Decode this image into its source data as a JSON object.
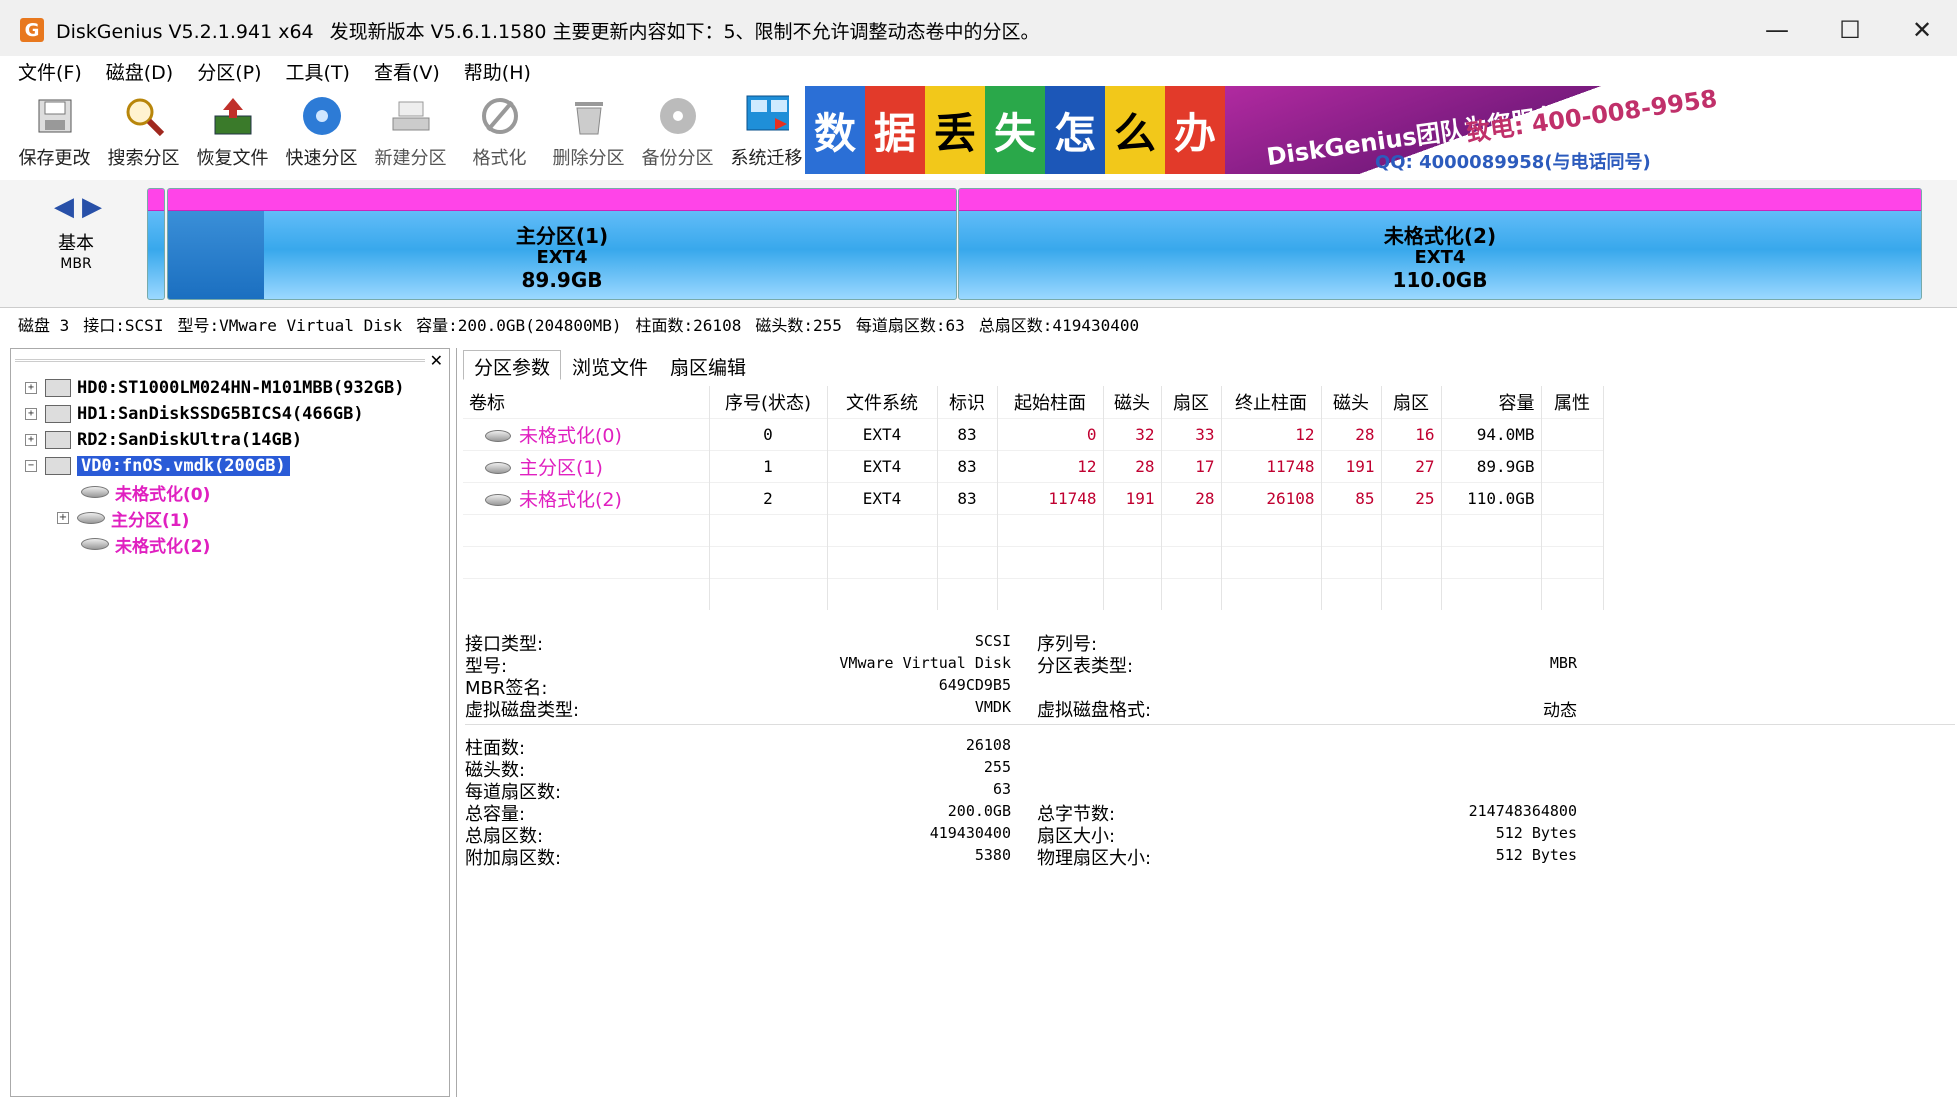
{
  "window": {
    "app_title": "DiskGenius V5.2.1.941 x64",
    "notice": "发现新版本 V5.6.1.1580 主要更新内容如下：5、限制不允许调整动态卷中的分区。",
    "min": "—",
    "max": "☐",
    "close": "✕"
  },
  "menu": [
    "文件(F)",
    "磁盘(D)",
    "分区(P)",
    "工具(T)",
    "查看(V)",
    "帮助(H)"
  ],
  "toolbar": [
    {
      "label": "保存更改",
      "icon": "save-icon"
    },
    {
      "label": "搜索分区",
      "icon": "search-icon"
    },
    {
      "label": "恢复文件",
      "icon": "recover-icon"
    },
    {
      "label": "快速分区",
      "icon": "quick-partition-icon"
    },
    {
      "label": "新建分区",
      "icon": "new-partition-icon"
    },
    {
      "label": "格式化",
      "icon": "format-icon"
    },
    {
      "label": "删除分区",
      "icon": "delete-icon"
    },
    {
      "label": "备份分区",
      "icon": "backup-icon"
    },
    {
      "label": "系统迁移",
      "icon": "migrate-icon"
    }
  ],
  "banner": {
    "chars": [
      "数",
      "据",
      "丢",
      "失",
      "怎",
      "么",
      "办"
    ],
    "line1": "DiskGenius团队为您服务!",
    "line2": "致电: 400-008-9958",
    "line3": "QQ: 4000089958(与电话同号)"
  },
  "diskmap": {
    "type_label": "基本",
    "table_label": "MBR",
    "partitions": [
      {
        "name": "主分区(1)",
        "fs": "EXT4",
        "size": "89.9GB"
      },
      {
        "name": "未格式化(2)",
        "fs": "EXT4",
        "size": "110.0GB"
      }
    ]
  },
  "infoline": {
    "disk": "磁盘 3",
    "iface": "接口:SCSI",
    "model": "型号:VMware Virtual Disk",
    "capacity": "容量:200.0GB(204800MB)",
    "cyl": "柱面数:26108",
    "heads": "磁头数:255",
    "spt": "每道扇区数:63",
    "total": "总扇区数:419430400"
  },
  "tree": {
    "disks": [
      {
        "label": "HD0:ST1000LM024HN-M101MBB(932GB)"
      },
      {
        "label": "HD1:SanDiskSSDG5BICS4(466GB)"
      },
      {
        "label": "RD2:SanDiskUltra(14GB)"
      },
      {
        "label": "VD0:fnOS.vmdk(200GB)"
      }
    ],
    "parts": [
      "未格式化(0)",
      "主分区(1)",
      "未格式化(2)"
    ]
  },
  "tabs": [
    "分区参数",
    "浏览文件",
    "扇区编辑"
  ],
  "table": {
    "headers": [
      "卷标",
      "序号(状态)",
      "文件系统",
      "标识",
      "起始柱面",
      "磁头",
      "扇区",
      "终止柱面",
      "磁头",
      "扇区",
      "容量",
      "属性"
    ],
    "rows": [
      {
        "vol": "未格式化(0)",
        "idx": "0",
        "fs": "EXT4",
        "id": "83",
        "sc": "0",
        "sh": "32",
        "ss": "33",
        "ec": "12",
        "eh": "28",
        "es": "16",
        "cap": "94.0MB",
        "attr": ""
      },
      {
        "vol": "主分区(1)",
        "idx": "1",
        "fs": "EXT4",
        "id": "83",
        "sc": "12",
        "sh": "28",
        "ss": "17",
        "ec": "11748",
        "eh": "191",
        "es": "27",
        "cap": "89.9GB",
        "attr": ""
      },
      {
        "vol": "未格式化(2)",
        "idx": "2",
        "fs": "EXT4",
        "id": "83",
        "sc": "11748",
        "sh": "191",
        "ss": "28",
        "ec": "26108",
        "eh": "85",
        "es": "25",
        "cap": "110.0GB",
        "attr": ""
      }
    ]
  },
  "details": {
    "iface_k": "接口类型:",
    "iface_v": "SCSI",
    "serial_k": "序列号:",
    "serial_v": "",
    "model_k": "型号:",
    "model_v": "VMware Virtual Disk",
    "ptype_k": "分区表类型:",
    "ptype_v": "MBR",
    "sig_k": "MBR签名:",
    "sig_v": "649CD9B5",
    "vtype_k": "虚拟磁盘类型:",
    "vtype_v": "VMDK",
    "vfmt_k": "虚拟磁盘格式:",
    "vfmt_v": "动态",
    "cyl_k": "柱面数:",
    "cyl_v": "26108",
    "heads_k": "磁头数:",
    "heads_v": "255",
    "spt_k": "每道扇区数:",
    "spt_v": "63",
    "cap_k": "总容量:",
    "cap_v": "200.0GB",
    "bytes_k": "总字节数:",
    "bytes_v": "214748364800",
    "sect_k": "总扇区数:",
    "sect_v": "419430400",
    "ssize_k": "扇区大小:",
    "ssize_v": "512 Bytes",
    "extra_k": "附加扇区数:",
    "extra_v": "5380",
    "phys_k": "物理扇区大小:",
    "phys_v": "512 Bytes"
  }
}
